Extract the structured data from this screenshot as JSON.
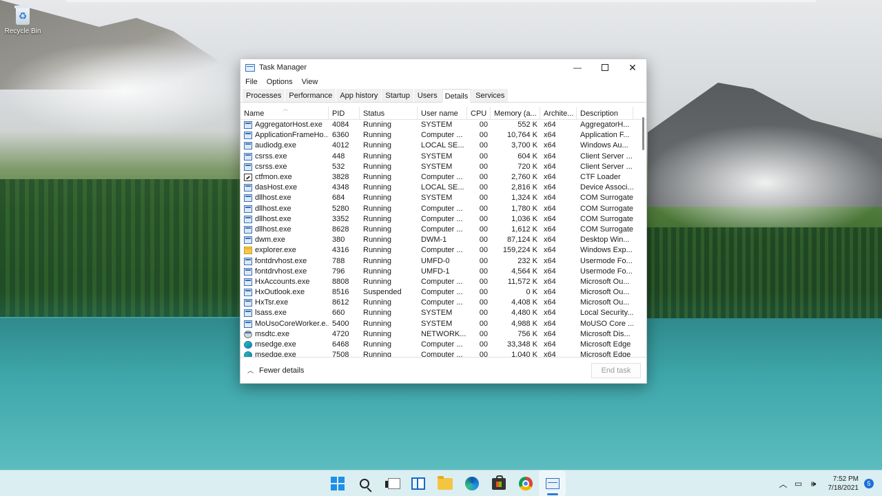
{
  "desktop": {
    "recycle_bin_label": "Recycle Bin"
  },
  "window": {
    "title": "Task Manager",
    "controls": {
      "minimize": "—",
      "close": "✕"
    },
    "menu": [
      "File",
      "Options",
      "View"
    ],
    "tabs": [
      {
        "label": "Processes",
        "active": false
      },
      {
        "label": "Performance",
        "active": false
      },
      {
        "label": "App history",
        "active": false
      },
      {
        "label": "Startup",
        "active": false
      },
      {
        "label": "Users",
        "active": false
      },
      {
        "label": "Details",
        "active": true
      },
      {
        "label": "Services",
        "active": false
      }
    ],
    "columns": [
      "Name",
      "PID",
      "Status",
      "User name",
      "CPU",
      "Memory (a...",
      "Archite...",
      "Description"
    ],
    "rows": [
      {
        "icon": "app-window-icon",
        "name": "AggregatorHost.exe",
        "pid": "4084",
        "status": "Running",
        "user": "SYSTEM",
        "cpu": "00",
        "mem": "552 K",
        "arch": "x64",
        "desc": "AggregatorH..."
      },
      {
        "icon": "app-window-icon",
        "name": "ApplicationFrameHo...",
        "pid": "6360",
        "status": "Running",
        "user": "Computer ...",
        "cpu": "00",
        "mem": "10,764 K",
        "arch": "x64",
        "desc": "Application F..."
      },
      {
        "icon": "app-window-icon",
        "name": "audiodg.exe",
        "pid": "4012",
        "status": "Running",
        "user": "LOCAL SE...",
        "cpu": "00",
        "mem": "3,700 K",
        "arch": "x64",
        "desc": "Windows Au..."
      },
      {
        "icon": "app-window-icon",
        "name": "csrss.exe",
        "pid": "448",
        "status": "Running",
        "user": "SYSTEM",
        "cpu": "00",
        "mem": "604 K",
        "arch": "x64",
        "desc": "Client Server ..."
      },
      {
        "icon": "app-window-icon",
        "name": "csrss.exe",
        "pid": "532",
        "status": "Running",
        "user": "SYSTEM",
        "cpu": "00",
        "mem": "720 K",
        "arch": "x64",
        "desc": "Client Server ..."
      },
      {
        "icon": "pen-icon",
        "name": "ctfmon.exe",
        "pid": "3828",
        "status": "Running",
        "user": "Computer ...",
        "cpu": "00",
        "mem": "2,760 K",
        "arch": "x64",
        "desc": "CTF Loader"
      },
      {
        "icon": "app-window-icon",
        "name": "dasHost.exe",
        "pid": "4348",
        "status": "Running",
        "user": "LOCAL SE...",
        "cpu": "00",
        "mem": "2,816 K",
        "arch": "x64",
        "desc": "Device Associ..."
      },
      {
        "icon": "app-window-icon",
        "name": "dllhost.exe",
        "pid": "684",
        "status": "Running",
        "user": "SYSTEM",
        "cpu": "00",
        "mem": "1,324 K",
        "arch": "x64",
        "desc": "COM Surrogate"
      },
      {
        "icon": "app-window-icon",
        "name": "dllhost.exe",
        "pid": "5280",
        "status": "Running",
        "user": "Computer ...",
        "cpu": "00",
        "mem": "1,780 K",
        "arch": "x64",
        "desc": "COM Surrogate"
      },
      {
        "icon": "app-window-icon",
        "name": "dllhost.exe",
        "pid": "3352",
        "status": "Running",
        "user": "Computer ...",
        "cpu": "00",
        "mem": "1,036 K",
        "arch": "x64",
        "desc": "COM Surrogate"
      },
      {
        "icon": "app-window-icon",
        "name": "dllhost.exe",
        "pid": "8628",
        "status": "Running",
        "user": "Computer ...",
        "cpu": "00",
        "mem": "1,612 K",
        "arch": "x64",
        "desc": "COM Surrogate"
      },
      {
        "icon": "app-window-icon",
        "name": "dwm.exe",
        "pid": "380",
        "status": "Running",
        "user": "DWM-1",
        "cpu": "00",
        "mem": "87,124 K",
        "arch": "x64",
        "desc": "Desktop Win..."
      },
      {
        "icon": "folder-icon",
        "name": "explorer.exe",
        "pid": "4316",
        "status": "Running",
        "user": "Computer ...",
        "cpu": "00",
        "mem": "159,224 K",
        "arch": "x64",
        "desc": "Windows Exp..."
      },
      {
        "icon": "app-window-icon",
        "name": "fontdrvhost.exe",
        "pid": "788",
        "status": "Running",
        "user": "UMFD-0",
        "cpu": "00",
        "mem": "232 K",
        "arch": "x64",
        "desc": "Usermode Fo..."
      },
      {
        "icon": "app-window-icon",
        "name": "fontdrvhost.exe",
        "pid": "796",
        "status": "Running",
        "user": "UMFD-1",
        "cpu": "00",
        "mem": "4,564 K",
        "arch": "x64",
        "desc": "Usermode Fo..."
      },
      {
        "icon": "app-window-icon",
        "name": "HxAccounts.exe",
        "pid": "8808",
        "status": "Running",
        "user": "Computer ...",
        "cpu": "00",
        "mem": "11,572 K",
        "arch": "x64",
        "desc": "Microsoft Ou..."
      },
      {
        "icon": "app-window-icon",
        "name": "HxOutlook.exe",
        "pid": "8516",
        "status": "Suspended",
        "user": "Computer ...",
        "cpu": "00",
        "mem": "0 K",
        "arch": "x64",
        "desc": "Microsoft Ou..."
      },
      {
        "icon": "app-window-icon",
        "name": "HxTsr.exe",
        "pid": "8612",
        "status": "Running",
        "user": "Computer ...",
        "cpu": "00",
        "mem": "4,408 K",
        "arch": "x64",
        "desc": "Microsoft Ou..."
      },
      {
        "icon": "app-window-icon",
        "name": "lsass.exe",
        "pid": "660",
        "status": "Running",
        "user": "SYSTEM",
        "cpu": "00",
        "mem": "4,480 K",
        "arch": "x64",
        "desc": "Local Security..."
      },
      {
        "icon": "app-window-icon",
        "name": "MoUsoCoreWorker.e...",
        "pid": "5400",
        "status": "Running",
        "user": "SYSTEM",
        "cpu": "00",
        "mem": "4,988 K",
        "arch": "x64",
        "desc": "MoUSO Core ..."
      },
      {
        "icon": "gear-icon",
        "name": "msdtc.exe",
        "pid": "4720",
        "status": "Running",
        "user": "NETWORK...",
        "cpu": "00",
        "mem": "756 K",
        "arch": "x64",
        "desc": "Microsoft Dis..."
      },
      {
        "icon": "edge-icon",
        "name": "msedge.exe",
        "pid": "6468",
        "status": "Running",
        "user": "Computer ...",
        "cpu": "00",
        "mem": "33,348 K",
        "arch": "x64",
        "desc": "Microsoft Edge"
      },
      {
        "icon": "edge-icon",
        "name": "msedge.exe",
        "pid": "7508",
        "status": "Running",
        "user": "Computer ...",
        "cpu": "00",
        "mem": "1,040 K",
        "arch": "x64",
        "desc": "Microsoft Edge"
      }
    ],
    "footer": {
      "fewer_details": "Fewer details",
      "end_task": "End task"
    }
  },
  "taskbar": {
    "apps": [
      {
        "icon": "windows-start-icon",
        "active": false
      },
      {
        "icon": "search-icon",
        "active": false
      },
      {
        "icon": "task-view-icon",
        "active": false
      },
      {
        "icon": "widgets-icon",
        "active": false
      },
      {
        "icon": "file-explorer-icon",
        "active": false
      },
      {
        "icon": "edge-browser-icon",
        "active": false
      },
      {
        "icon": "microsoft-store-icon",
        "active": false
      },
      {
        "icon": "chrome-icon",
        "active": false
      },
      {
        "icon": "task-manager-icon",
        "active": true
      }
    ],
    "tray": {
      "chevron": "︿",
      "time": "7:52 PM",
      "date": "7/18/2021",
      "notification_count": "5"
    }
  },
  "colors": {
    "accent": "#1e90e8",
    "taskbar_bg": "#dbeef2"
  }
}
